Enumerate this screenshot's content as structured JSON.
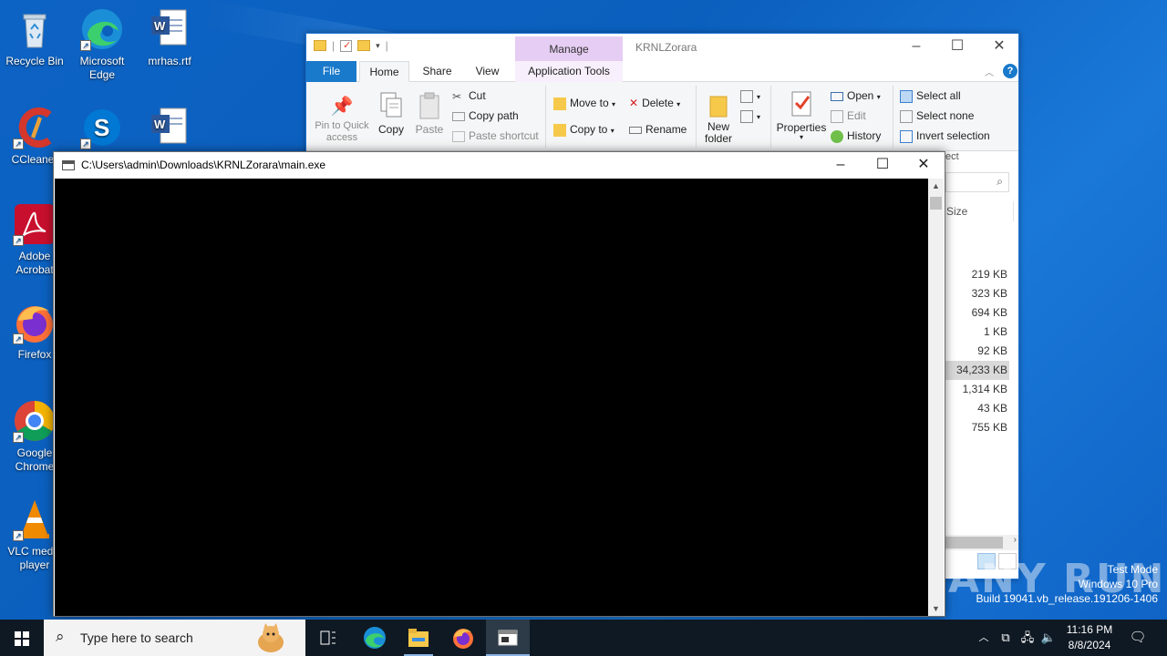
{
  "desktop": {
    "icons": [
      {
        "label": "Recycle Bin"
      },
      {
        "label": "Microsoft Edge"
      },
      {
        "label": "mrhas.rtf"
      },
      {
        "label": "CCleaner"
      },
      {
        "label": "Adobe Acrobat"
      },
      {
        "label": "Firefox"
      },
      {
        "label": "Google Chrome"
      },
      {
        "label": "VLC media player"
      }
    ]
  },
  "explorer": {
    "context_tab": "Manage",
    "window_title": "KRNLZorara",
    "tabs": {
      "file": "File",
      "home": "Home",
      "share": "Share",
      "view": "View",
      "app_tools": "Application Tools"
    },
    "ribbon": {
      "pin": "Pin to Quick access",
      "copy": "Copy",
      "paste": "Paste",
      "cut": "Cut",
      "copy_path": "Copy path",
      "paste_shortcut": "Paste shortcut",
      "move_to": "Move to",
      "copy_to": "Copy to",
      "delete": "Delete",
      "rename": "Rename",
      "new_folder": "New folder",
      "properties": "Properties",
      "open": "Open",
      "edit": "Edit",
      "history": "History",
      "select_all": "Select all",
      "select_none": "Select none",
      "invert_selection": "Invert selection",
      "select_group_tail": "ect"
    },
    "column_size": "Size",
    "sizes": [
      "219 KB",
      "323 KB",
      "694 KB",
      "1 KB",
      "92 KB",
      "34,233 KB",
      "1,314 KB",
      "43 KB",
      "755 KB"
    ],
    "selected_index": 5
  },
  "console": {
    "title": "C:\\Users\\admin\\Downloads\\KRNLZorara\\main.exe"
  },
  "watermark": {
    "brand": "ANY RUN",
    "line1": "Test Mode",
    "line2": "Windows 10 Pro",
    "line3": "Build 19041.vb_release.191206-1406"
  },
  "taskbar": {
    "search_placeholder": "Type here to search",
    "time": "11:16 PM",
    "date": "8/8/2024"
  }
}
